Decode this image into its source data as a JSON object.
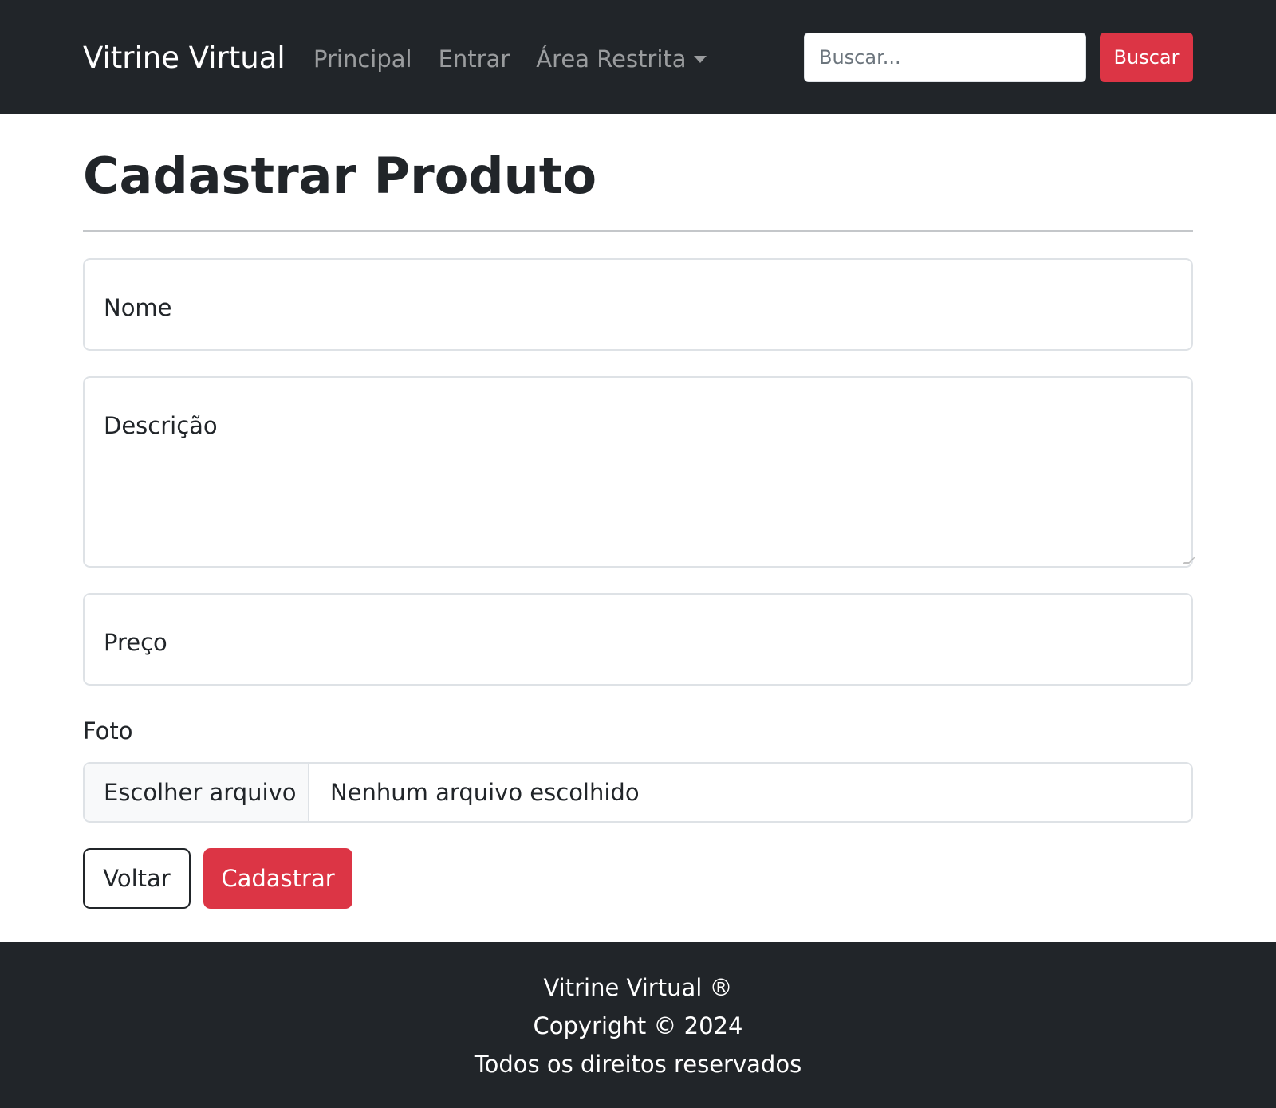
{
  "navbar": {
    "brand": "Vitrine Virtual",
    "links": [
      {
        "label": "Principal"
      },
      {
        "label": "Entrar"
      },
      {
        "label": "Área Restrita"
      }
    ],
    "search": {
      "placeholder": "Buscar...",
      "button_label": "Buscar"
    }
  },
  "page": {
    "title": "Cadastrar Produto"
  },
  "form": {
    "fields": {
      "nome": {
        "label": "Nome"
      },
      "descricao": {
        "label": "Descrição"
      },
      "preco": {
        "label": "Preço"
      }
    },
    "foto": {
      "label": "Foto",
      "button_label": "Escolher arquivo",
      "status": "Nenhum arquivo escolhido"
    },
    "buttons": {
      "voltar": "Voltar",
      "cadastrar": "Cadastrar"
    }
  },
  "footer": {
    "line1": "Vitrine Virtual  ®",
    "line2": "Copyright © 2024",
    "line3": "Todos os direitos reservados"
  },
  "colors": {
    "navbar_bg": "#212529",
    "accent": "#dc3545",
    "border": "#dee2e6"
  }
}
